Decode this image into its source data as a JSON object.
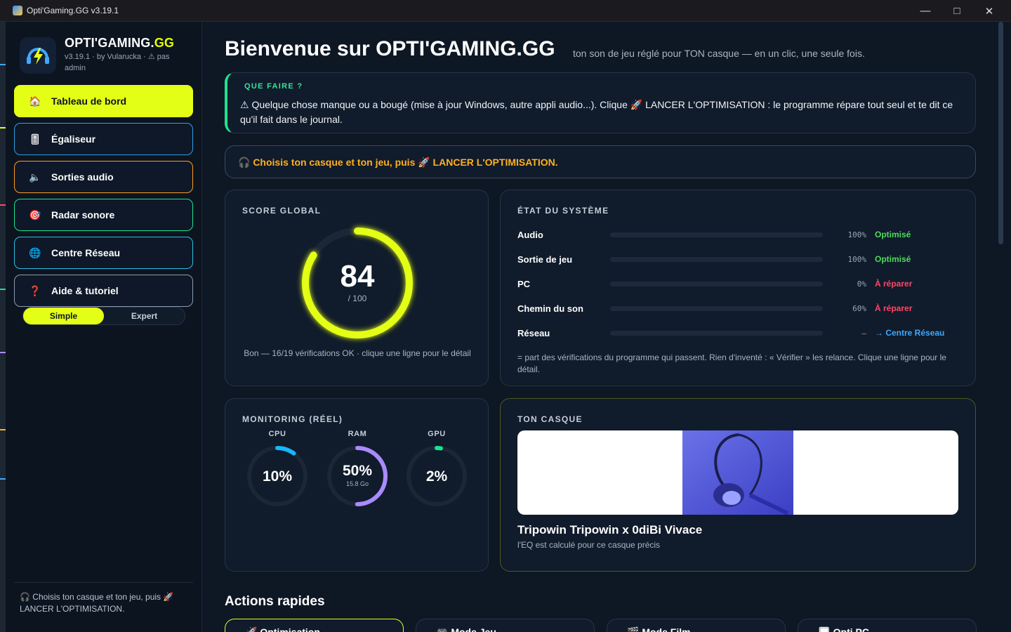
{
  "window": {
    "title": "Opti'Gaming.GG v3.19.1"
  },
  "sidebar": {
    "brand_main": "OPTI'GAMING.",
    "brand_accent": "GG",
    "brand_sub": "v3.19.1 · by Vularucka · ⚠ pas admin",
    "items": [
      {
        "label": "Tableau de bord",
        "icon": "home-icon",
        "glyph": "🏠",
        "active": true
      },
      {
        "label": "Égaliseur",
        "icon": "equalizer-icon",
        "glyph": "🎚",
        "active": false
      },
      {
        "label": "Sorties audio",
        "icon": "speaker-icon",
        "glyph": "🔈",
        "active": false
      },
      {
        "label": "Radar sonore",
        "icon": "target-icon",
        "glyph": "🎯",
        "active": false
      },
      {
        "label": "Centre Réseau",
        "icon": "globe-icon",
        "glyph": "🌐",
        "active": false
      },
      {
        "label": "Aide & tutoriel",
        "icon": "question-icon",
        "glyph": "❓",
        "active": false
      }
    ],
    "mode_simple": "Simple",
    "mode_expert": "Expert",
    "footer": "🎧 Choisis ton casque et ton jeu, puis 🚀 LANCER L'OPTIMISATION."
  },
  "colors": {
    "accent": "#e4ff16",
    "ok": "#4ddc5b",
    "bad": "#ff4767",
    "link": "#3fa9ff",
    "warn": "#ffb020",
    "cpu": "#18b6ff",
    "ram": "#a98bff",
    "gpu": "#1de38c"
  },
  "header": {
    "title": "Bienvenue sur OPTI'GAMING.GG",
    "subtitle": "ton son de jeu réglé pour TON casque — en un clic, une seule fois."
  },
  "hint": {
    "label": "QUE FAIRE ?",
    "text": "⚠ Quelque chose manque ou a bougé (mise à jour Windows, autre appli audio...). Clique 🚀 LANCER L'OPTIMISATION : le programme répare tout seul et te dit ce qu'il fait dans le journal."
  },
  "cta": {
    "text": "🎧 Choisis ton casque et ton jeu, puis 🚀 LANCER L'OPTIMISATION."
  },
  "score": {
    "label": "SCORE GLOBAL",
    "value": "84",
    "max": "/ 100",
    "fraction": 0.84,
    "caption": "Bon — 16/19 vérifications OK · clique une ligne pour le détail"
  },
  "system": {
    "label": "ÉTAT DU SYSTÈME",
    "rows": [
      {
        "name": "Audio",
        "pct": "100%",
        "value": 1.0,
        "status": "Optimisé",
        "kind": "ok"
      },
      {
        "name": "Sortie de jeu",
        "pct": "100%",
        "value": 1.0,
        "status": "Optimisé",
        "kind": "ok"
      },
      {
        "name": "PC",
        "pct": "0%",
        "value": 0.0,
        "status": "À réparer",
        "kind": "bad"
      },
      {
        "name": "Chemin du son",
        "pct": "60%",
        "value": 0.6,
        "status": "À réparer",
        "kind": "bad"
      },
      {
        "name": "Réseau",
        "pct": "—",
        "value": 0.0,
        "status": "→ Centre Réseau",
        "kind": "link"
      }
    ],
    "note": "= part des vérifications du programme qui passent. Rien d'inventé : « Vérifier » les relance. Clique une ligne pour le détail."
  },
  "monitoring": {
    "label": "MONITORING (RÉEL)",
    "gauges": [
      {
        "name": "CPU",
        "value": "10%",
        "sub": "",
        "fraction": 0.1,
        "color": "#18b6ff"
      },
      {
        "name": "RAM",
        "value": "50%",
        "sub": "15.8 Go",
        "fraction": 0.5,
        "color": "#a98bff"
      },
      {
        "name": "GPU",
        "value": "2%",
        "sub": "",
        "fraction": 0.02,
        "color": "#1de38c"
      }
    ]
  },
  "headset": {
    "label": "TON CASQUE",
    "name": "Tripowin Tripowin x 0diBi Vivace",
    "desc": "l'EQ est calculé pour ce casque précis"
  },
  "quick": {
    "title": "Actions rapides",
    "items": [
      {
        "label": "🚀 Optimisation",
        "icon": "rocket-icon"
      },
      {
        "label": "🎮 Mode Jeu",
        "icon": "gamepad-icon"
      },
      {
        "label": "🎬 Mode Film",
        "icon": "clapper-icon"
      },
      {
        "label": "🖥 Opti PC",
        "icon": "monitor-icon"
      }
    ]
  }
}
